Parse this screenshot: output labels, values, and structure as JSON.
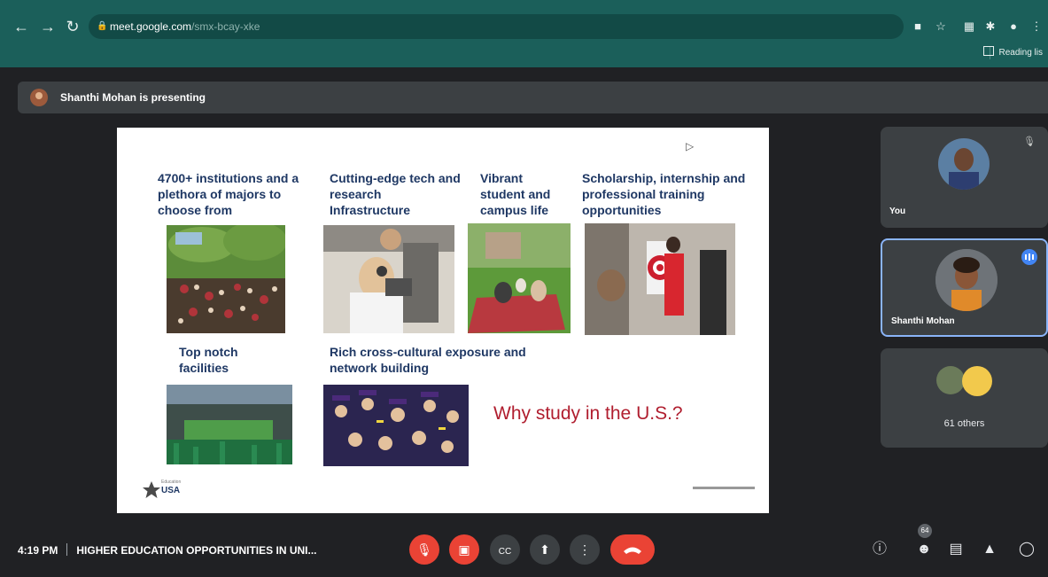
{
  "browser": {
    "url_host": "meet.google.com",
    "url_path": "/smx-bcay-xke",
    "reading_list_label": "Reading lis"
  },
  "presenting_bar": {
    "text": "Shanthi Mohan is presenting"
  },
  "slide": {
    "captions": [
      "4700+ institutions and a plethora of majors to choose from",
      "Cutting-edge tech and research Infrastructure",
      "Vibrant student and campus life",
      "Scholarship, internship and professional training opportunities",
      "Top notch facilities",
      "Rich cross-cultural exposure and network building"
    ],
    "headline": "Why study in the U.S.?",
    "logo_text": "USA",
    "logo_small": "Education"
  },
  "participants": {
    "self_label": "You",
    "presenter_label": "Shanthi Mohan",
    "others_label": "61 others"
  },
  "bottom_bar": {
    "time": "4:19 PM",
    "meeting_title": "HIGHER EDUCATION OPPORTUNITIES IN UNI...",
    "participants_count": "64"
  },
  "colors": {
    "browser_teal": "#1b5f5a",
    "meet_background": "#202124",
    "tile_background": "#3c4043",
    "end_call_red": "#ea4335",
    "speaking_blue": "#4285f4",
    "slide_caption_blue": "#1f3864",
    "slide_headline_red": "#b01e2f"
  },
  "icons": {
    "back": "arrow-left-icon",
    "forward": "arrow-right-icon",
    "reload": "reload-icon",
    "lock": "lock-icon",
    "camera_ext": "camera-icon",
    "bookmark": "star-icon",
    "extensions": "puzzle-icon",
    "mic_off": "mic-off-icon",
    "camera_off": "camera-off-icon",
    "captions": "captions-icon",
    "present": "present-icon",
    "more": "more-vert-icon",
    "end_call": "phone-hangup-icon",
    "info": "info-icon",
    "people": "people-icon",
    "chat": "chat-icon",
    "activities": "activities-icon",
    "host_controls": "shield-icon"
  }
}
